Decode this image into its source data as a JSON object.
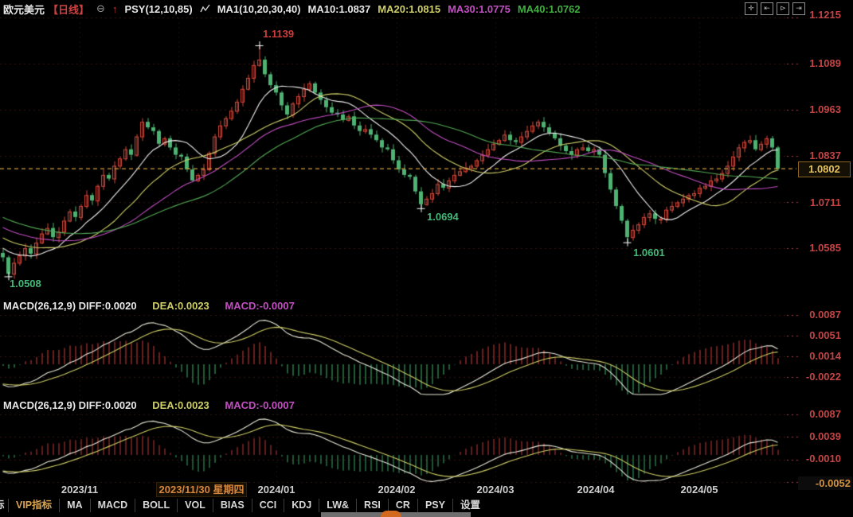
{
  "title_bar": {
    "symbol": "欧元美元",
    "period": "【日线】",
    "collapse_icon": "⊖",
    "up_arrow": "↑",
    "psy_label": "PSY(12,10,85)",
    "ma_group_label": "MA1(10,20,30,40)",
    "ma10": "MA10:1.0837",
    "ma20": "MA20:1.0815",
    "ma30": "MA30:1.0775",
    "ma40": "MA40:1.0762"
  },
  "main_axis": {
    "labels": [
      "1.1215",
      "1.1089",
      "1.0963",
      "1.0837",
      "1.0711",
      "1.0585"
    ],
    "last_price": "1.0802"
  },
  "annotations": {
    "high": "1.1139",
    "low_feb": "1.0694",
    "low_apr": "1.0601",
    "low_oct": "1.0508"
  },
  "macd1": {
    "header_left": "MACD(26,12,9) DIFF:0.0020",
    "dea": "DEA:0.0023",
    "macd": "MACD:-0.0007",
    "axis": [
      "0.0087",
      "0.0051",
      "0.0014",
      "-0.0022"
    ]
  },
  "macd2": {
    "header_left": "MACD(26,12,9) DIFF:0.0020",
    "dea": "DEA:0.0023",
    "macd": "MACD:-0.0007",
    "axis": [
      "0.0087",
      "0.0039",
      "-0.0010"
    ],
    "crosshair_value": "-0.0052"
  },
  "x_axis": {
    "labels": [
      "2023/11",
      "2024/01",
      "2024/02",
      "2024/03",
      "2024/04",
      "2024/05"
    ],
    "crosshair_date": "2023/11/30 星期四"
  },
  "toolbar": {
    "partial_label": "标",
    "vip": "VIP指标",
    "items": [
      "MA",
      "MACD",
      "BOLL",
      "VOL",
      "BIAS",
      "CCI",
      "KDJ",
      "LW&",
      "RSI",
      "CR",
      "PSY",
      "设置"
    ]
  },
  "colors": {
    "up_candle": "#d24638",
    "down_candle": "#4eb273",
    "ma10": "#efefef",
    "ma20": "#cfcf6a",
    "ma30": "#c24ec2",
    "ma40": "#54a854",
    "axis_red": "#c24444",
    "last_price_line": "#cfa040",
    "diff_line": "#e7e7d9",
    "dea_line": "#cdcd67",
    "hist_up": "#bf3a3a",
    "hist_down": "#3da868",
    "highlight_orange": "#d6863c"
  },
  "chart_data": {
    "type": "candlestick",
    "title": "欧元美元 日线 (EUR/USD daily)",
    "y_axis_ticks": [
      1.1215,
      1.1089,
      1.0963,
      1.0837,
      1.0711,
      1.0585
    ],
    "last_price": 1.0802,
    "x_tick_labels": [
      "2023/11",
      "2024/01",
      "2024/02",
      "2024/03",
      "2024/04",
      "2024/05"
    ],
    "ma_periods": [
      10,
      20,
      30,
      40
    ],
    "macd_params": [
      26,
      12,
      9
    ],
    "macd1_axis_ticks": [
      0.0087,
      0.0051,
      0.0014,
      -0.0022
    ],
    "macd2_axis_ticks": [
      0.0087,
      0.0039,
      -0.001,
      -0.0052
    ],
    "extremes": {
      "1": {
        "low": 1.0508
      },
      "46": {
        "high": 1.1139
      },
      "75": {
        "low": 1.0694
      },
      "112": {
        "low": 1.0601
      }
    },
    "closes": [
      1.056,
      1.0515,
      1.0545,
      1.0565,
      1.0585,
      1.057,
      1.06,
      1.0625,
      1.064,
      1.0615,
      1.063,
      1.066,
      1.0685,
      1.067,
      1.07,
      1.073,
      1.0715,
      1.0755,
      1.0785,
      1.0775,
      1.081,
      1.083,
      1.0855,
      1.084,
      1.089,
      1.093,
      1.0915,
      1.0905,
      1.087,
      1.0885,
      1.086,
      1.084,
      1.0835,
      1.08,
      1.077,
      1.0785,
      1.08,
      1.0845,
      1.089,
      1.092,
      1.094,
      1.096,
      1.0985,
      1.102,
      1.105,
      1.1085,
      1.11,
      1.106,
      1.103,
      1.101,
      1.0975,
      1.095,
      1.098,
      1.1,
      1.102,
      1.1035,
      1.101,
      1.099,
      1.097,
      1.0955,
      1.095,
      1.0935,
      1.0945,
      1.092,
      1.0905,
      1.091,
      1.0895,
      1.088,
      1.086,
      1.0855,
      1.0825,
      1.08,
      1.0785,
      1.078,
      1.074,
      1.0705,
      1.072,
      1.0735,
      1.076,
      1.075,
      1.077,
      1.0785,
      1.0795,
      1.0805,
      1.081,
      1.0825,
      1.084,
      1.0855,
      1.087,
      1.088,
      1.0895,
      1.088,
      1.0875,
      1.089,
      1.0905,
      1.092,
      1.093,
      1.0915,
      1.09,
      1.0885,
      1.0865,
      1.085,
      1.084,
      1.0855,
      1.086,
      1.085,
      1.0855,
      1.084,
      1.079,
      1.0745,
      1.07,
      1.066,
      1.0615,
      1.0635,
      1.065,
      1.067,
      1.068,
      1.0665,
      1.0665,
      1.069,
      1.07,
      1.071,
      1.072,
      1.073,
      1.0735,
      1.075,
      1.0755,
      1.077,
      1.0775,
      1.079,
      1.081,
      1.0835,
      1.086,
      1.0875,
      1.088,
      1.0855,
      1.087,
      1.0885,
      1.086,
      1.0802
    ]
  }
}
